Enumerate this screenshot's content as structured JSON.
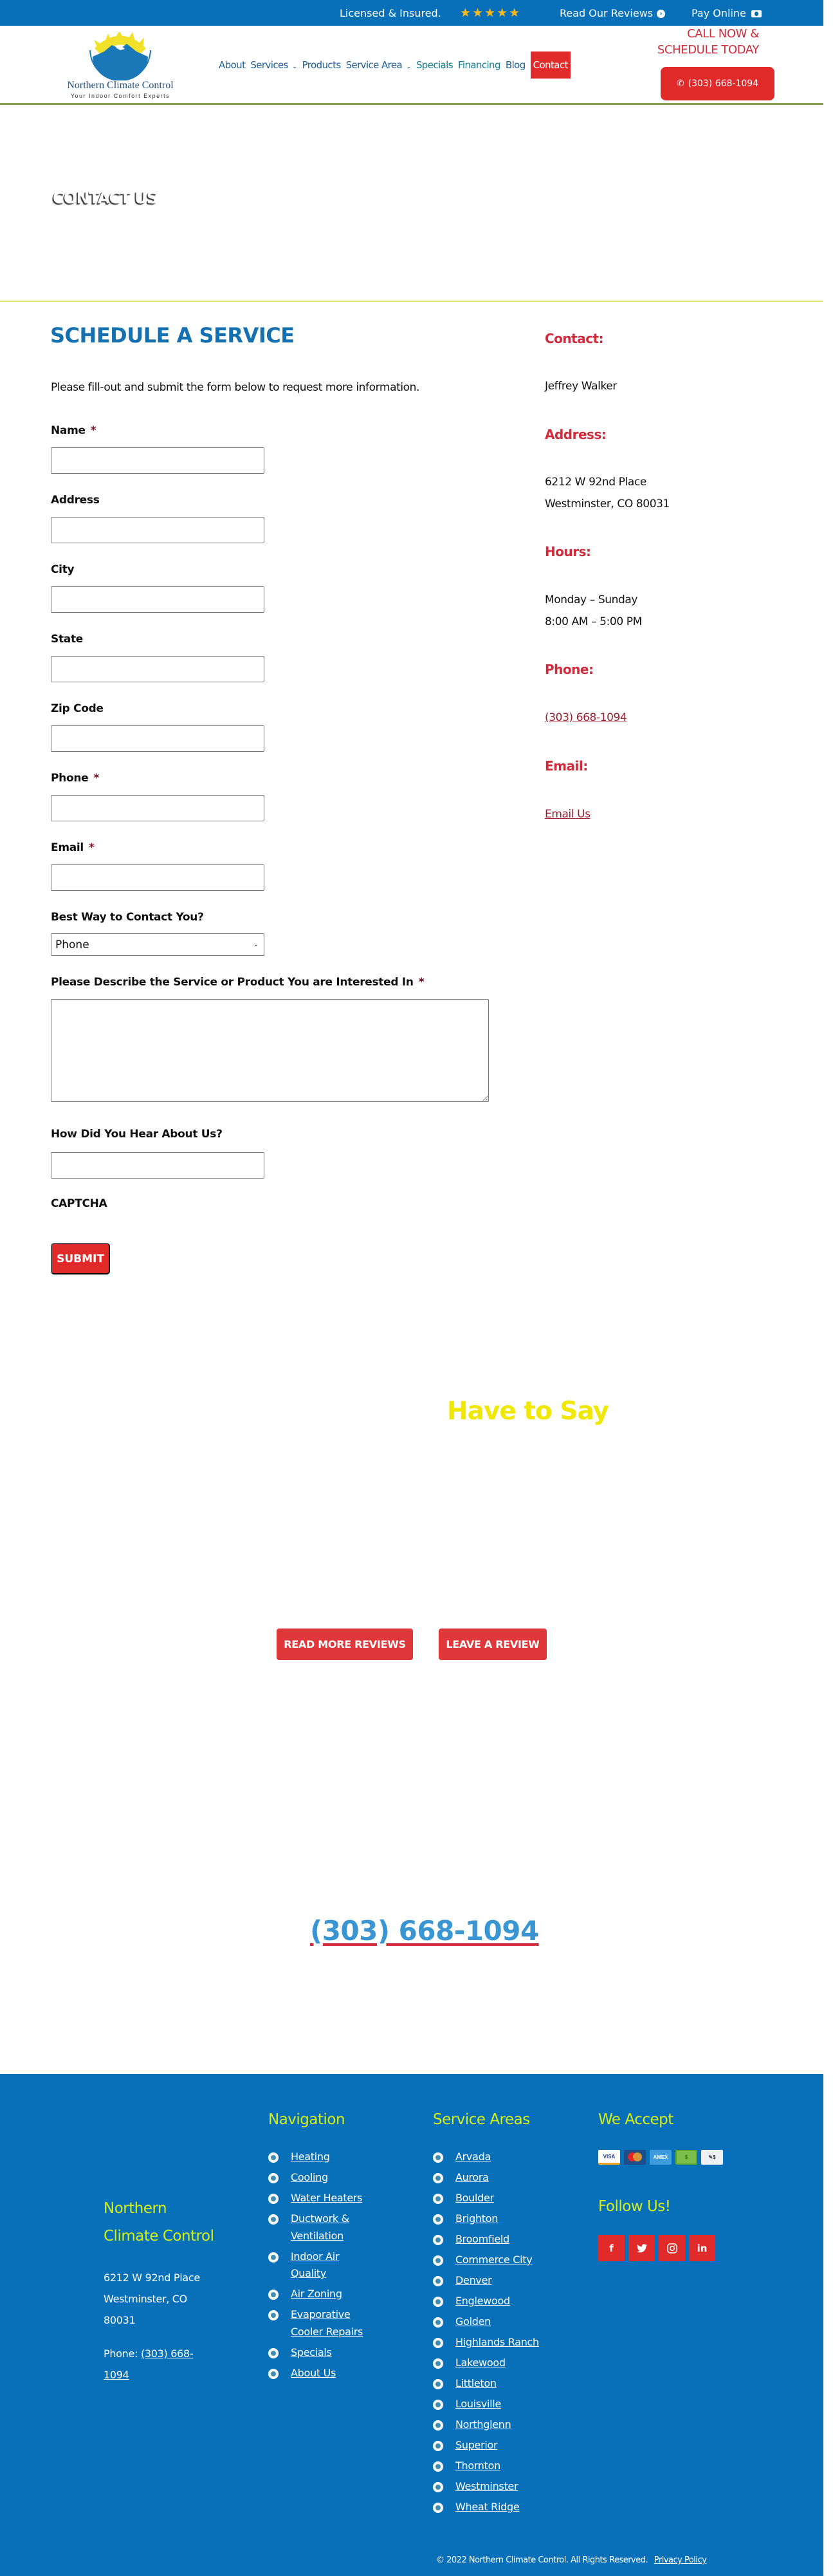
{
  "topbar": {
    "licensed": "Licensed & Insured.",
    "stars": "★★★★★",
    "star_rating": 5,
    "reviews_link": "Read Our Reviews",
    "pay_online": "Pay Online"
  },
  "header": {
    "logo_name": "Northern Climate Control",
    "logo_tagline": "Your Indoor Comfort Experts",
    "nav": [
      {
        "label": "About"
      },
      {
        "label": "Services",
        "has_dropdown": true
      },
      {
        "label": "Products"
      },
      {
        "label": "Service Area",
        "has_dropdown": true
      },
      {
        "label": "Specials"
      },
      {
        "label": "Financing"
      },
      {
        "label": "Blog"
      },
      {
        "label": "Contact",
        "active": true
      }
    ],
    "cta_line1": "CALL NOW &",
    "cta_line2": "SCHEDULE TODAY",
    "cta_phone": "(303) 668-1094"
  },
  "hero": {
    "title": "CONTACT US"
  },
  "form": {
    "title": "SCHEDULE A SERVICE",
    "intro": "Please fill-out and submit the form below to request more information.",
    "required_mark": "*",
    "fields": [
      {
        "label": "Name",
        "required": true,
        "value": ""
      },
      {
        "label": "Address",
        "required": false,
        "value": ""
      },
      {
        "label": "City",
        "required": false,
        "value": ""
      },
      {
        "label": "State",
        "required": false,
        "value": ""
      },
      {
        "label": "Zip Code",
        "required": false,
        "value": ""
      },
      {
        "label": "Phone",
        "required": true,
        "value": ""
      },
      {
        "label": "Email",
        "required": true,
        "value": ""
      }
    ],
    "contact_method_label": "Best Way to Contact You?",
    "contact_method_value": "Phone",
    "description_label": "Please Describe the Service or Product You are Interested In",
    "hear_label": "How Did You Hear About Us?",
    "captcha_label": "CAPTCHA",
    "submit_label": "SUBMIT"
  },
  "sidebar": {
    "contact_heading": "Contact:",
    "contact_name": "Jeffrey Walker",
    "address_heading": "Address:",
    "address_line1": "6212 W 92nd Place",
    "address_line2": "Westminster, CO 80031",
    "hours_heading": "Hours:",
    "hours_days": "Monday – Sunday",
    "hours_time": "8:00 AM – 5:00 PM",
    "phone_heading": "Phone:",
    "phone": "(303) 668-1094",
    "email_heading": "Email:",
    "email_link": "Email Us"
  },
  "reviews": {
    "title_visible": "Have to Say",
    "read_more": "READ MORE REVIEWS",
    "leave_review": "LEAVE A REVIEW"
  },
  "call_section": {
    "phone": "(303) 668-1094"
  },
  "footer": {
    "company_line1": "Northern",
    "company_line2": "Climate Control",
    "address_line1": "6212 W 92nd Place",
    "address_line2": "Westminster, CO",
    "address_line3": "80031",
    "phone_label": "Phone:",
    "phone": "(303) 668-1094",
    "nav_heading": "Navigation",
    "nav_links": [
      "Heating",
      "Cooling",
      "Water Heaters",
      "Ductwork & Ventilation",
      "Indoor Air Quality",
      "Air Zoning",
      "Evaporative Cooler Repairs",
      "Specials",
      "About Us"
    ],
    "areas_heading": "Service Areas",
    "areas": [
      "Arvada",
      "Aurora",
      "Boulder",
      "Brighton",
      "Broomfield",
      "Commerce City",
      "Denver",
      "Englewood",
      "Golden",
      "Highlands Ranch",
      "Lakewood",
      "Littleton",
      "Louisville",
      "Northglenn",
      "Superior",
      "Thornton",
      "Westminster",
      "Wheat Ridge"
    ],
    "accept_heading": "We Accept",
    "payment_methods": [
      {
        "name": "visa",
        "label": "VISA"
      },
      {
        "name": "mastercard",
        "label": ""
      },
      {
        "name": "amex",
        "label": "AMEX"
      },
      {
        "name": "cash",
        "label": "$"
      },
      {
        "name": "check",
        "label": "✎$"
      }
    ],
    "follow_heading": "Follow Us!",
    "social": [
      {
        "name": "facebook",
        "glyph": "f"
      },
      {
        "name": "twitter",
        "glyph": "t"
      },
      {
        "name": "instagram",
        "glyph": "◎"
      },
      {
        "name": "linkedin",
        "glyph": "in"
      }
    ],
    "copyright": "© 2022 Northern Climate Control.  All Rights Reserved.",
    "privacy": "Privacy Policy"
  },
  "colors": {
    "brand_blue": "#0870b8",
    "accent_red": "#e12b2b",
    "heading_red": "#d22b3c",
    "accent_yellow": "#d6ee1a",
    "title_blue": "#1470b0"
  }
}
